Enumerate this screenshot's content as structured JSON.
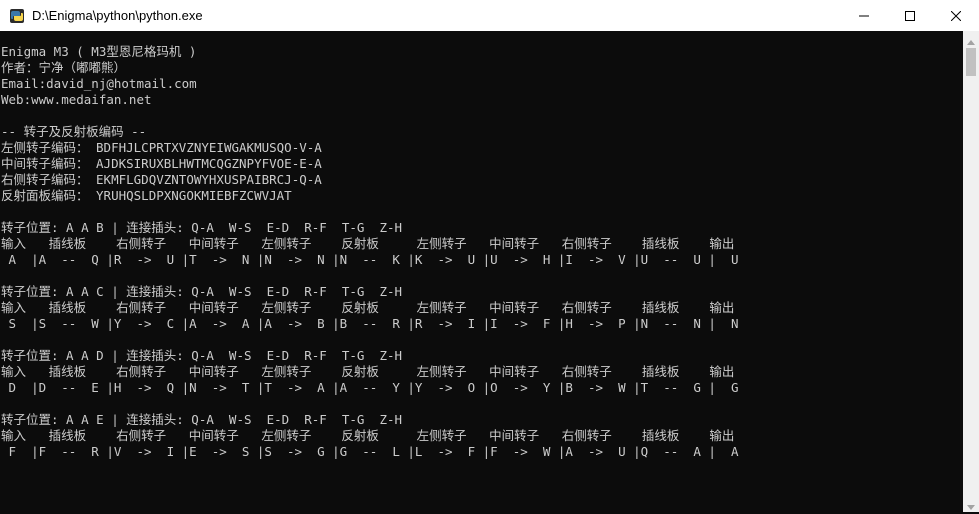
{
  "window": {
    "title": "D:\\Enigma\\python\\python.exe",
    "icon": "python-icon",
    "controls": [
      "minimize-icon",
      "maximize-icon",
      "close-icon"
    ]
  },
  "colors": {
    "console_bg": "#0c0c0c",
    "console_fg": "#cccccc",
    "titlebar_bg": "#ffffff",
    "scrollbar_bg": "#f0f0f0",
    "scrollbar_thumb": "#c1c1c1"
  },
  "console": {
    "lines": [
      "Enigma M3 ( M3型恩尼格玛机 )",
      "作者：宁净（嘟嘟熊）",
      "Email:david_nj@hotmail.com",
      "Web:www.medaifan.net",
      "",
      "-- 转子及反射板编码 --",
      "左侧转子编码： BDFHJLCPRTXVZNYEIWGAKMUSQO-V-A",
      "中间转子编码： AJDKSIRUXBLHWTMCQGZNPYFVOE-E-A",
      "右侧转子编码： EKMFLGDQVZNTOWYHXUSPAIBRCJ-Q-A",
      "反射面板编码： YRUHQSLDPXNGOKMIEBFZCWVJAT",
      "",
      "转子位置: A A B | 连接插头: Q-A  W-S  E-D  R-F  T-G  Z-H",
      "输入   插线板    右侧转子   中间转子   左侧转子    反射板     左侧转子   中间转子   右侧转子    插线板    输出",
      " A  |A  --  Q |R  ->  U |T  ->  N |N  ->  N |N  --  K |K  ->  U |U  ->  H |I  ->  V |U  --  U |  U",
      "",
      "转子位置: A A C | 连接插头: Q-A  W-S  E-D  R-F  T-G  Z-H",
      "输入   插线板    右侧转子   中间转子   左侧转子    反射板     左侧转子   中间转子   右侧转子    插线板    输出",
      " S  |S  --  W |Y  ->  C |A  ->  A |A  ->  B |B  --  R |R  ->  I |I  ->  F |H  ->  P |N  --  N |  N",
      "",
      "转子位置: A A D | 连接插头: Q-A  W-S  E-D  R-F  T-G  Z-H",
      "输入   插线板    右侧转子   中间转子   左侧转子    反射板     左侧转子   中间转子   右侧转子    插线板    输出",
      " D  |D  --  E |H  ->  Q |N  ->  T |T  ->  A |A  --  Y |Y  ->  O |O  ->  Y |B  ->  W |T  --  G |  G",
      "",
      "转子位置: A A E | 连接插头: Q-A  W-S  E-D  R-F  T-G  Z-H",
      "输入   插线板    右侧转子   中间转子   左侧转子    反射板     左侧转子   中间转子   右侧转子    插线板    输出",
      " F  |F  --  R |V  ->  I |E  ->  S |S  ->  G |G  --  L |L  ->  F |F  ->  W |A  ->  U |Q  --  A |  A"
    ]
  }
}
